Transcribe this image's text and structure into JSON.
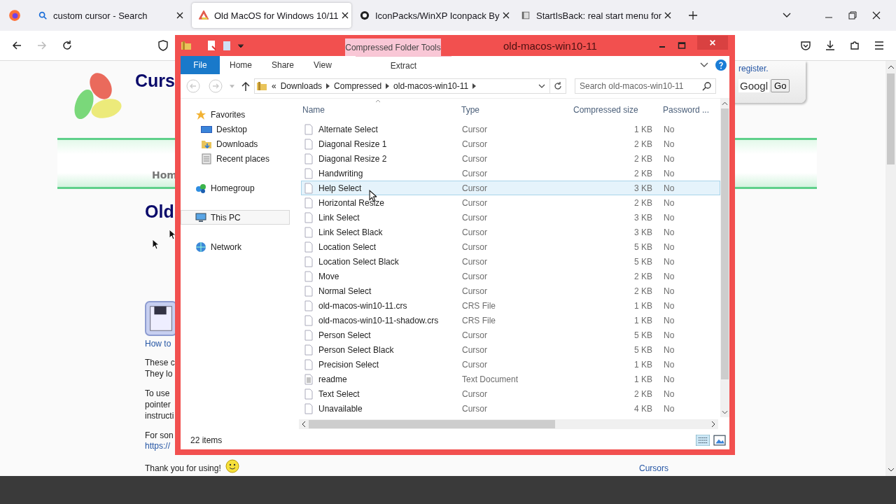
{
  "browser": {
    "tabs": [
      {
        "title": "custom cursor - Search",
        "selected": false
      },
      {
        "title": "Old MacOS for Windows 10/11",
        "selected": true
      },
      {
        "title": "IconPacks/WinXP Iconpack By",
        "selected": false
      },
      {
        "title": "StartIsBack: real start menu for",
        "selected": false
      }
    ]
  },
  "page": {
    "site_title": "Curs",
    "nav_link": "Hom",
    "heading": "Old",
    "download_link": "How to",
    "paragraphs": [
      [
        "These c",
        "They lo"
      ],
      [
        "To use",
        "pointer",
        "instructi"
      ],
      [
        "For son"
      ]
    ],
    "url_link": "https://",
    "thanks": "Thank you for using!",
    "login_link": "register.",
    "search_value": "Googl",
    "go_button": "Go",
    "footer_link": "Cursors"
  },
  "explorer": {
    "title": "old-macos-win10-11",
    "context_tab": "Compressed Folder Tools",
    "ribbon_tabs": [
      {
        "label": "File",
        "kind": "file"
      },
      {
        "label": "Home",
        "kind": "tab"
      },
      {
        "label": "Share",
        "kind": "tab"
      },
      {
        "label": "View",
        "kind": "tab"
      },
      {
        "label": "Extract",
        "kind": "context"
      }
    ],
    "address": {
      "prefix": "«",
      "crumbs": [
        "Downloads",
        "Compressed",
        "old-macos-win10-11"
      ]
    },
    "search": {
      "placeholder": "Search old-macos-win10-11"
    },
    "nav": [
      {
        "label": "Favorites",
        "selected": false,
        "children": [
          {
            "label": "Desktop",
            "selected": false
          },
          {
            "label": "Downloads",
            "selected": false
          },
          {
            "label": "Recent places",
            "selected": false
          }
        ]
      },
      {
        "label": "Homegroup",
        "selected": false
      },
      {
        "label": "This PC",
        "selected": true
      },
      {
        "label": "Network",
        "selected": false
      }
    ],
    "columns": [
      "Name",
      "Type",
      "Compressed size",
      "Password ..."
    ],
    "rows": [
      {
        "name": "Alternate Select",
        "type": "Cursor",
        "size": "1 KB",
        "password": "No",
        "kind": "file",
        "selected": false
      },
      {
        "name": "Diagonal Resize 1",
        "type": "Cursor",
        "size": "2 KB",
        "password": "No",
        "kind": "file",
        "selected": false
      },
      {
        "name": "Diagonal Resize 2",
        "type": "Cursor",
        "size": "2 KB",
        "password": "No",
        "kind": "file",
        "selected": false
      },
      {
        "name": "Handwriting",
        "type": "Cursor",
        "size": "2 KB",
        "password": "No",
        "kind": "file",
        "selected": false
      },
      {
        "name": "Help Select",
        "type": "Cursor",
        "size": "3 KB",
        "password": "No",
        "kind": "file",
        "selected": true
      },
      {
        "name": "Horizontal Resize",
        "type": "Cursor",
        "size": "2 KB",
        "password": "No",
        "kind": "file",
        "selected": false
      },
      {
        "name": "Link Select",
        "type": "Cursor",
        "size": "3 KB",
        "password": "No",
        "kind": "file",
        "selected": false
      },
      {
        "name": "Link Select Black",
        "type": "Cursor",
        "size": "3 KB",
        "password": "No",
        "kind": "file",
        "selected": false
      },
      {
        "name": "Location Select",
        "type": "Cursor",
        "size": "5 KB",
        "password": "No",
        "kind": "file",
        "selected": false
      },
      {
        "name": "Location Select Black",
        "type": "Cursor",
        "size": "5 KB",
        "password": "No",
        "kind": "file",
        "selected": false
      },
      {
        "name": "Move",
        "type": "Cursor",
        "size": "2 KB",
        "password": "No",
        "kind": "file",
        "selected": false
      },
      {
        "name": "Normal Select",
        "type": "Cursor",
        "size": "2 KB",
        "password": "No",
        "kind": "file",
        "selected": false
      },
      {
        "name": "old-macos-win10-11.crs",
        "type": "CRS File",
        "size": "1 KB",
        "password": "No",
        "kind": "file",
        "selected": false
      },
      {
        "name": "old-macos-win10-11-shadow.crs",
        "type": "CRS File",
        "size": "1 KB",
        "password": "No",
        "kind": "file",
        "selected": false
      },
      {
        "name": "Person Select",
        "type": "Cursor",
        "size": "5 KB",
        "password": "No",
        "kind": "file",
        "selected": false
      },
      {
        "name": "Person Select Black",
        "type": "Cursor",
        "size": "5 KB",
        "password": "No",
        "kind": "file",
        "selected": false
      },
      {
        "name": "Precision Select",
        "type": "Cursor",
        "size": "1 KB",
        "password": "No",
        "kind": "file",
        "selected": false
      },
      {
        "name": "readme",
        "type": "Text Document",
        "size": "1 KB",
        "password": "No",
        "kind": "text",
        "selected": false
      },
      {
        "name": "Text Select",
        "type": "Cursor",
        "size": "2 KB",
        "password": "No",
        "kind": "file",
        "selected": false
      },
      {
        "name": "Unavailable",
        "type": "Cursor",
        "size": "4 KB",
        "password": "No",
        "kind": "file",
        "selected": false
      }
    ],
    "status": "22 items"
  }
}
